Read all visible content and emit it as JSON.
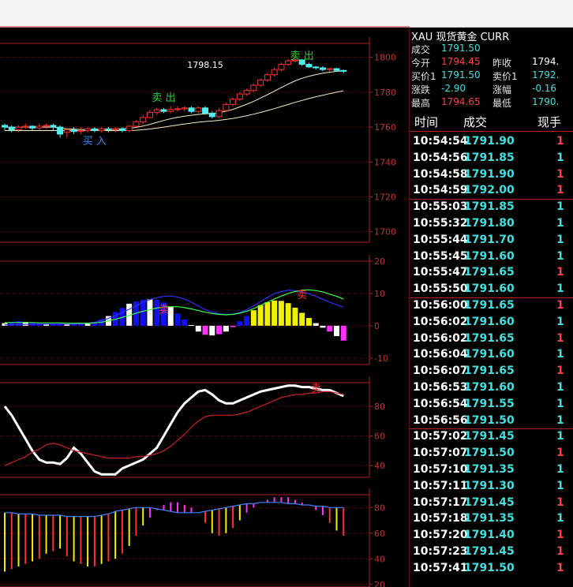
{
  "quote": {
    "title": "XAU 现货黄金   CURR",
    "rows": [
      {
        "l1": "成交",
        "v1": "1791.50",
        "c1": "#40e0e0",
        "l2": "",
        "v2": "",
        "c2": "#ff4040"
      },
      {
        "l1": "今开",
        "v1": "1794.45",
        "c1": "#ff4040",
        "l2": "昨收",
        "v2": "1794.",
        "c2": "#ffffff"
      },
      {
        "l1": "买价1",
        "v1": "1791.50",
        "c1": "#40e0e0",
        "l2": "卖价1",
        "v2": "1792.",
        "c2": "#40e0e0"
      },
      {
        "l1": "涨跌",
        "v1": "-2.90",
        "c1": "#40e0e0",
        "l2": "涨幅",
        "v2": "-0.16",
        "c2": "#40e0e0"
      },
      {
        "l1": "最高",
        "v1": "1794.65",
        "c1": "#ff4040",
        "l2": "最低",
        "v2": "1790.",
        "c2": "#40e0e0"
      }
    ]
  },
  "ticks_header": {
    "time": "时间",
    "price": "成交",
    "vol": "现手"
  },
  "ticks": [
    {
      "time": "10:54:54",
      "price": "1791.90",
      "vol": "1",
      "vc": "#ff4040"
    },
    {
      "time": "10:54:56",
      "price": "1791.85",
      "vol": "1",
      "vc": "#40e0e0"
    },
    {
      "time": "10:54:58",
      "price": "1791.90",
      "vol": "1",
      "vc": "#ff4040"
    },
    {
      "time": "10:54:59",
      "price": "1792.00",
      "vol": "1",
      "vc": "#ff4040"
    },
    {
      "time": "10:55:03",
      "price": "1791.85",
      "vol": "1",
      "vc": "#40e0e0"
    },
    {
      "time": "10:55:32",
      "price": "1791.80",
      "vol": "1",
      "vc": "#40e0e0"
    },
    {
      "time": "10:55:44",
      "price": "1791.70",
      "vol": "1",
      "vc": "#40e0e0"
    },
    {
      "time": "10:55:45",
      "price": "1791.60",
      "vol": "1",
      "vc": "#40e0e0"
    },
    {
      "time": "10:55:47",
      "price": "1791.65",
      "vol": "1",
      "vc": "#ff4040"
    },
    {
      "time": "10:55:50",
      "price": "1791.60",
      "vol": "1",
      "vc": "#40e0e0"
    },
    {
      "time": "10:56:00",
      "price": "1791.65",
      "vol": "1",
      "vc": "#ff4040"
    },
    {
      "time": "10:56:02",
      "price": "1791.60",
      "vol": "1",
      "vc": "#40e0e0"
    },
    {
      "time": "10:56:02",
      "price": "1791.65",
      "vol": "1",
      "vc": "#ff4040"
    },
    {
      "time": "10:56:04",
      "price": "1791.60",
      "vol": "1",
      "vc": "#40e0e0"
    },
    {
      "time": "10:56:07",
      "price": "1791.65",
      "vol": "1",
      "vc": "#ff4040"
    },
    {
      "time": "10:56:53",
      "price": "1791.60",
      "vol": "1",
      "vc": "#40e0e0"
    },
    {
      "time": "10:56:54",
      "price": "1791.55",
      "vol": "1",
      "vc": "#40e0e0"
    },
    {
      "time": "10:56:56",
      "price": "1791.50",
      "vol": "1",
      "vc": "#40e0e0"
    },
    {
      "time": "10:57:02",
      "price": "1791.45",
      "vol": "1",
      "vc": "#40e0e0"
    },
    {
      "time": "10:57:07",
      "price": "1791.50",
      "vol": "1",
      "vc": "#ff4040"
    },
    {
      "time": "10:57:10",
      "price": "1791.35",
      "vol": "1",
      "vc": "#40e0e0"
    },
    {
      "time": "10:57:11",
      "price": "1791.30",
      "vol": "1",
      "vc": "#40e0e0"
    },
    {
      "time": "10:57:17",
      "price": "1791.45",
      "vol": "1",
      "vc": "#ff4040"
    },
    {
      "time": "10:57:18",
      "price": "1791.35",
      "vol": "1",
      "vc": "#40e0e0"
    },
    {
      "time": "10:57:20",
      "price": "1791.40",
      "vol": "1",
      "vc": "#ff4040"
    },
    {
      "time": "10:57:23",
      "price": "1791.45",
      "vol": "1",
      "vc": "#ff4040"
    },
    {
      "time": "10:57:41",
      "price": "1791.50",
      "vol": "1",
      "vc": "#ff4040"
    }
  ],
  "chart_data": [
    {
      "type": "candlestick",
      "y_ticks": [
        "1800",
        "1780",
        "1760",
        "1740",
        "1720",
        "1700"
      ],
      "ylim": [
        1694,
        1808
      ],
      "candles": [
        {
          "o": 1761.0,
          "c": 1760.0,
          "h": 1762,
          "l": 1758
        },
        {
          "o": 1760.0,
          "c": 1758.5,
          "h": 1761,
          "l": 1757
        },
        {
          "o": 1758.5,
          "c": 1760.0,
          "h": 1761,
          "l": 1757
        },
        {
          "o": 1760.0,
          "c": 1760.5,
          "h": 1762,
          "l": 1759
        },
        {
          "o": 1760.5,
          "c": 1759.5,
          "h": 1761,
          "l": 1758
        },
        {
          "o": 1759.5,
          "c": 1760.5,
          "h": 1762,
          "l": 1758
        },
        {
          "o": 1760.5,
          "c": 1761.0,
          "h": 1762,
          "l": 1759
        },
        {
          "o": 1761.0,
          "c": 1760.0,
          "h": 1762,
          "l": 1758
        },
        {
          "o": 1760.0,
          "c": 1756.0,
          "h": 1761,
          "l": 1754
        },
        {
          "o": 1757.0,
          "c": 1758.5,
          "h": 1759,
          "l": 1754
        },
        {
          "o": 1758.5,
          "c": 1757.5,
          "h": 1760,
          "l": 1756
        },
        {
          "o": 1757.5,
          "c": 1758.0,
          "h": 1760,
          "l": 1756
        },
        {
          "o": 1758.0,
          "c": 1759.0,
          "h": 1760,
          "l": 1757
        },
        {
          "o": 1759.0,
          "c": 1758.0,
          "h": 1760,
          "l": 1757
        },
        {
          "o": 1758.0,
          "c": 1759.0,
          "h": 1760,
          "l": 1757
        },
        {
          "o": 1759.0,
          "c": 1758.5,
          "h": 1760,
          "l": 1757
        },
        {
          "o": 1758.5,
          "c": 1759.0,
          "h": 1760,
          "l": 1757
        },
        {
          "o": 1759.0,
          "c": 1758.0,
          "h": 1760,
          "l": 1757
        },
        {
          "o": 1758.0,
          "c": 1760.5,
          "h": 1761,
          "l": 1757
        },
        {
          "o": 1760.5,
          "c": 1763.0,
          "h": 1764,
          "l": 1760
        },
        {
          "o": 1763.0,
          "c": 1765.5,
          "h": 1767,
          "l": 1762
        },
        {
          "o": 1765.5,
          "c": 1768.5,
          "h": 1770,
          "l": 1765
        },
        {
          "o": 1768.5,
          "c": 1770.0,
          "h": 1771,
          "l": 1767
        },
        {
          "o": 1770.0,
          "c": 1769.0,
          "h": 1771,
          "l": 1768
        },
        {
          "o": 1769.0,
          "c": 1770.0,
          "h": 1772,
          "l": 1768
        },
        {
          "o": 1770.0,
          "c": 1770.5,
          "h": 1772,
          "l": 1769
        },
        {
          "o": 1770.5,
          "c": 1771.0,
          "h": 1772,
          "l": 1769
        },
        {
          "o": 1771.0,
          "c": 1769.0,
          "h": 1772,
          "l": 1768
        },
        {
          "o": 1769.0,
          "c": 1771.0,
          "h": 1772,
          "l": 1768
        },
        {
          "o": 1771.0,
          "c": 1768.0,
          "h": 1772,
          "l": 1767
        },
        {
          "o": 1768.0,
          "c": 1766.0,
          "h": 1769,
          "l": 1765
        },
        {
          "o": 1766.0,
          "c": 1769.5,
          "h": 1771,
          "l": 1765
        },
        {
          "o": 1769.5,
          "c": 1773.0,
          "h": 1774,
          "l": 1769
        },
        {
          "o": 1773.0,
          "c": 1776.0,
          "h": 1777,
          "l": 1772
        },
        {
          "o": 1776.0,
          "c": 1779.0,
          "h": 1780,
          "l": 1775
        },
        {
          "o": 1779.0,
          "c": 1781.0,
          "h": 1782,
          "l": 1778
        },
        {
          "o": 1781.0,
          "c": 1784.0,
          "h": 1785,
          "l": 1780
        },
        {
          "o": 1784.0,
          "c": 1787.0,
          "h": 1788,
          "l": 1783
        },
        {
          "o": 1787.0,
          "c": 1790.0,
          "h": 1791,
          "l": 1786
        },
        {
          "o": 1790.0,
          "c": 1793.0,
          "h": 1794,
          "l": 1789
        },
        {
          "o": 1793.0,
          "c": 1796.0,
          "h": 1797,
          "l": 1792
        },
        {
          "o": 1796.0,
          "c": 1798.0,
          "h": 1799,
          "l": 1795
        },
        {
          "o": 1798.0,
          "c": 1798.5,
          "h": 1799,
          "l": 1797
        },
        {
          "o": 1798.5,
          "c": 1796.0,
          "h": 1799,
          "l": 1795
        },
        {
          "o": 1796.0,
          "c": 1794.5,
          "h": 1797,
          "l": 1794
        },
        {
          "o": 1794.5,
          "c": 1794.0,
          "h": 1795,
          "l": 1793
        },
        {
          "o": 1794.0,
          "c": 1793.0,
          "h": 1795,
          "l": 1792
        },
        {
          "o": 1793.0,
          "c": 1793.5,
          "h": 1794,
          "l": 1792
        },
        {
          "o": 1793.5,
          "c": 1792.5,
          "h": 1794,
          "l": 1792
        },
        {
          "o": 1792.5,
          "c": 1792.0,
          "h": 1793,
          "l": 1791
        }
      ],
      "ma_fast": [
        1760,
        1760,
        1760,
        1760,
        1760,
        1760,
        1760,
        1760,
        1759.5,
        1759,
        1758.8,
        1758.6,
        1758.6,
        1758.6,
        1758.7,
        1758.8,
        1758.9,
        1759,
        1759.3,
        1759.8,
        1760.6,
        1761.6,
        1762.7,
        1763.8,
        1764.8,
        1765.6,
        1766.3,
        1766.8,
        1767.3,
        1767.6,
        1767.8,
        1768.3,
        1769.1,
        1770.2,
        1771.6,
        1773.1,
        1774.8,
        1776.7,
        1778.6,
        1780.6,
        1782.7,
        1784.7,
        1786.5,
        1788,
        1789.2,
        1790.1,
        1790.9,
        1791.5,
        1792,
        1792.3
      ],
      "ma_slow": [
        1758,
        1758,
        1758,
        1758,
        1758,
        1758,
        1758,
        1758,
        1758,
        1758,
        1758,
        1758,
        1758,
        1758,
        1758,
        1758,
        1758,
        1758,
        1758,
        1758.2,
        1758.5,
        1758.9,
        1759.4,
        1760,
        1760.6,
        1761.2,
        1761.8,
        1762.3,
        1762.8,
        1763.2,
        1763.5,
        1763.9,
        1764.4,
        1765,
        1765.7,
        1766.5,
        1767.4,
        1768.4,
        1769.5,
        1770.6,
        1771.8,
        1773,
        1774.2,
        1775.3,
        1776.4,
        1777.4,
        1778.3,
        1779.2,
        1780,
        1780.8
      ],
      "annotations": [
        {
          "text": "买 入",
          "candle": 13,
          "value": 1750
        },
        {
          "text": "卖 出",
          "candle": 23,
          "value": 1775
        },
        {
          "text": "卖 出",
          "candle": 43,
          "value": 1799
        },
        {
          "text": "1798.15",
          "candle": 29,
          "value": 1794
        }
      ]
    },
    {
      "type": "histogram",
      "y_ticks": [
        "20",
        "10",
        "0",
        "-10"
      ],
      "ylim": [
        -12,
        20
      ],
      "bars": [
        0.8,
        1.2,
        1.4,
        1.2,
        1.0,
        0.8,
        0.5,
        0.6,
        0.8,
        0.6,
        0.4,
        0.6,
        0.6,
        1.2,
        2,
        3,
        4.3,
        5.5,
        6.8,
        7.5,
        8,
        8.2,
        8,
        7.2,
        5.8,
        3.8,
        2,
        0.2,
        -1.8,
        -2.8,
        -3,
        -2.6,
        -1.8,
        -0.4,
        1.4,
        3,
        4.8,
        6.4,
        7.3,
        7.8,
        7.7,
        7,
        5.6,
        4,
        2.4,
        0.8,
        -0.6,
        -1.8,
        -3.2,
        -4.6
      ],
      "line_blue": [
        0.3,
        0.3,
        0.3,
        0.4,
        0.4,
        0.5,
        0.5,
        0.5,
        0.5,
        0.5,
        0.5,
        0.6,
        0.8,
        1.1,
        1.6,
        2.3,
        3.1,
        4.1,
        5.1,
        6.2,
        7.3,
        8.1,
        8.7,
        9.1,
        9.2,
        8.9,
        8.2,
        7.3,
        6.1,
        5,
        4.2,
        3.7,
        3.5,
        3.6,
        4.1,
        5,
        6.2,
        7.5,
        8.8,
        9.9,
        10.6,
        11,
        10.9,
        10.5,
        9.9,
        9.1,
        8.2,
        7.3,
        6.5,
        5.8
      ],
      "line_green": [
        1,
        1,
        1,
        1,
        1,
        0.9,
        0.9,
        0.9,
        0.9,
        0.8,
        0.8,
        0.8,
        0.8,
        0.9,
        1.1,
        1.5,
        2,
        2.6,
        3.2,
        3.9,
        4.5,
        5,
        5.5,
        5.8,
        5.9,
        5.9,
        5.6,
        5.2,
        4.7,
        4.2,
        3.8,
        3.5,
        3.4,
        3.5,
        3.9,
        4.5,
        5.3,
        6.3,
        7.3,
        8.3,
        9.2,
        10,
        10.6,
        11,
        11.1,
        10.9,
        10.5,
        9.8,
        9.1,
        8.3
      ],
      "annotations": [
        {
          "text": "卖",
          "candle": 23,
          "value": 4
        },
        {
          "text": "卖",
          "candle": 43,
          "value": 8.5
        }
      ]
    },
    {
      "type": "line",
      "y_ticks": [
        "80",
        "60",
        "40"
      ],
      "ylim": [
        32,
        96
      ],
      "series": [
        {
          "values": [
            80,
            74,
            66,
            58,
            50,
            44,
            42,
            42,
            41,
            45,
            52,
            48,
            42,
            36,
            34,
            34,
            34,
            38,
            40,
            42,
            44,
            48,
            52,
            60,
            68,
            76,
            82,
            86,
            90,
            91,
            88,
            84,
            82,
            82,
            84,
            86,
            88,
            90,
            91,
            92,
            93,
            94,
            94,
            93,
            93,
            92,
            91,
            91,
            89,
            87
          ],
          "color": "#ffffff"
        },
        {
          "values": [
            40,
            42,
            44,
            46,
            49,
            51,
            54,
            55,
            54,
            52,
            50,
            49,
            48,
            47,
            46,
            45,
            45,
            45,
            45,
            46,
            46,
            47,
            48,
            50,
            53,
            57,
            61,
            66,
            70,
            73,
            74,
            74,
            74,
            74,
            75,
            76,
            78,
            80,
            82,
            84,
            86,
            87,
            88,
            88,
            89,
            89,
            90,
            90,
            89,
            88
          ],
          "color": "#d02020"
        }
      ],
      "annotations": [
        {
          "text": "卖",
          "candle": 45,
          "value": 90
        }
      ]
    },
    {
      "type": "histogram",
      "y_ticks": [
        "80",
        "60",
        "40",
        "20"
      ],
      "ylim": [
        18,
        90
      ],
      "bars": [
        30,
        32,
        34,
        36,
        38,
        40,
        44,
        46,
        48,
        42,
        38,
        36,
        34,
        34,
        36,
        38,
        40,
        44,
        50,
        58,
        66,
        72,
        78,
        82,
        84,
        84,
        82,
        80,
        76,
        68,
        60,
        58,
        60,
        64,
        70,
        76,
        80,
        84,
        86,
        88,
        88,
        88,
        86,
        84,
        82,
        78,
        74,
        68,
        62,
        58
      ],
      "line": [
        76,
        76,
        75,
        75,
        75,
        74,
        74,
        74,
        74,
        73,
        73,
        73,
        73,
        73,
        74,
        75,
        77,
        78,
        79,
        80,
        80,
        80,
        79,
        78,
        77,
        76,
        76,
        76,
        76,
        77,
        78,
        79,
        80,
        81,
        82,
        83,
        83,
        84,
        84,
        84,
        84,
        83,
        83,
        82,
        82,
        81,
        81,
        80,
        80,
        80
      ]
    }
  ]
}
